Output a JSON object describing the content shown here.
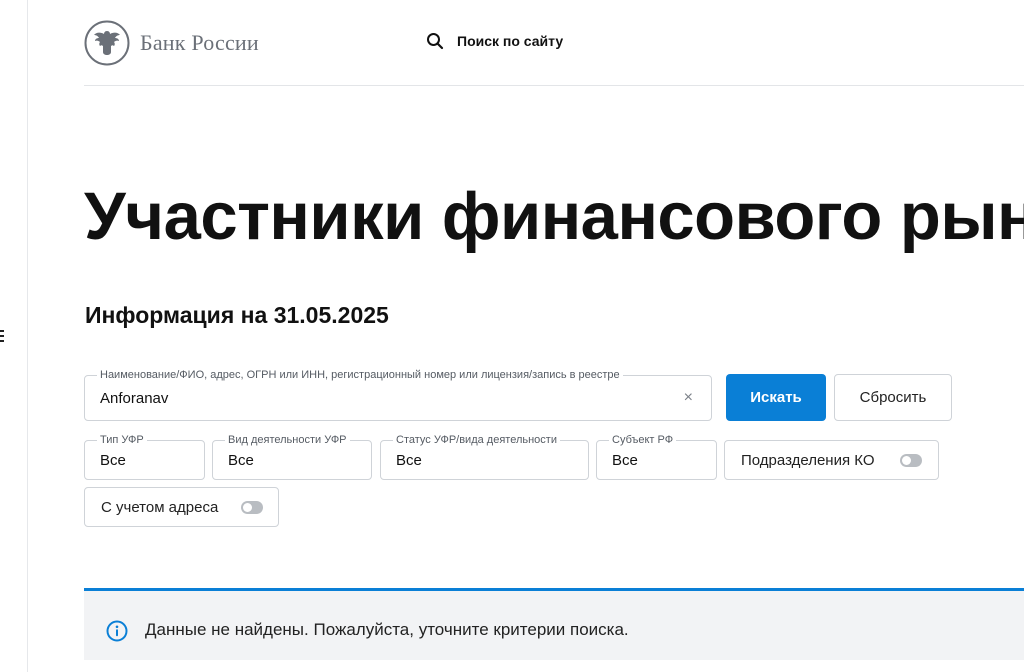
{
  "header": {
    "logo_text": "Банк России",
    "search_label": "Поиск по сайту"
  },
  "page": {
    "title": "Участники финансового рын",
    "info_date": "Информация на 31.05.2025"
  },
  "search": {
    "legend": "Наименование/ФИО, адрес, ОГРН или ИНН, регистрационный номер или лицензия/запись в реестре",
    "value": "Anforanav",
    "clear_glyph": "×",
    "search_button": "Искать",
    "reset_button": "Сбросить"
  },
  "filters": [
    {
      "legend": "Тип УФР",
      "value": "Все"
    },
    {
      "legend": "Вид деятельности УФР",
      "value": "Все"
    },
    {
      "legend": "Статус УФР/вида деятельности",
      "value": "Все"
    },
    {
      "legend": "Субъект РФ",
      "value": "Все"
    }
  ],
  "toggles": {
    "subdivisions_ko": {
      "label": "Подразделения КО",
      "on": false
    },
    "with_address": {
      "label": "С учетом адреса",
      "on": false
    }
  },
  "alert": {
    "message": "Данные не найдены. Пожалуйста, уточните критерии поиска."
  },
  "colors": {
    "accent": "#0a7fd6",
    "alert_bg": "#f2f3f5",
    "border": "#cfd3d8",
    "logo_gray": "#6b7078"
  },
  "icons": [
    "hamburger-menu-icon",
    "bank-emblem-icon",
    "search-icon",
    "clear-icon",
    "info-icon"
  ]
}
